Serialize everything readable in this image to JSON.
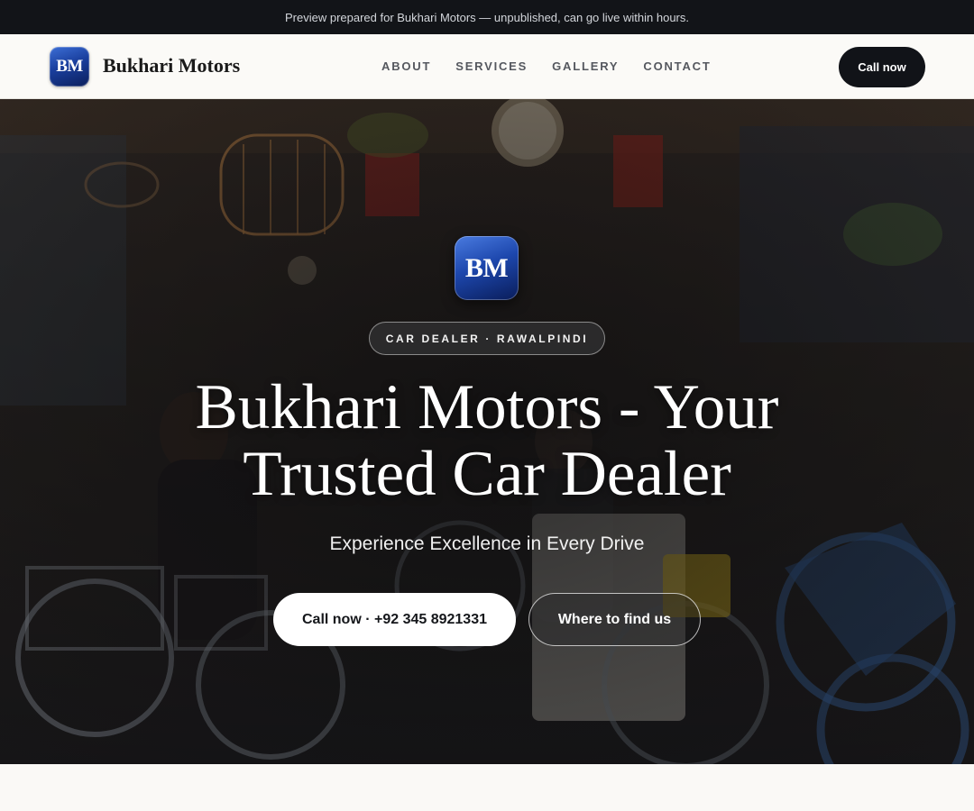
{
  "announcement": {
    "text": "Preview prepared for Bukhari Motors — unpublished, can go live within hours."
  },
  "header": {
    "logo_initials": "BM",
    "brand_name": "Bukhari Motors",
    "nav": [
      {
        "label": "ABOUT"
      },
      {
        "label": "SERVICES"
      },
      {
        "label": "GALLERY"
      },
      {
        "label": "CONTACT"
      }
    ],
    "call_label": "Call now"
  },
  "hero": {
    "logo_initials": "BM",
    "badge": "CAR DEALER · RAWALPINDI",
    "title_line1": "Bukhari Motors - Your",
    "title_line2": "Trusted Car Dealer",
    "subtitle": "Experience Excellence in Every Drive",
    "cta_primary": "Call now · +92 345 8921331",
    "cta_secondary": "Where to find us"
  },
  "colors": {
    "topbar_bg": "#121418",
    "header_bg": "#fbfaf7",
    "primary_button": "#111318",
    "logo_blue": "#1d47ad",
    "page_bg": "#faf9f6"
  }
}
